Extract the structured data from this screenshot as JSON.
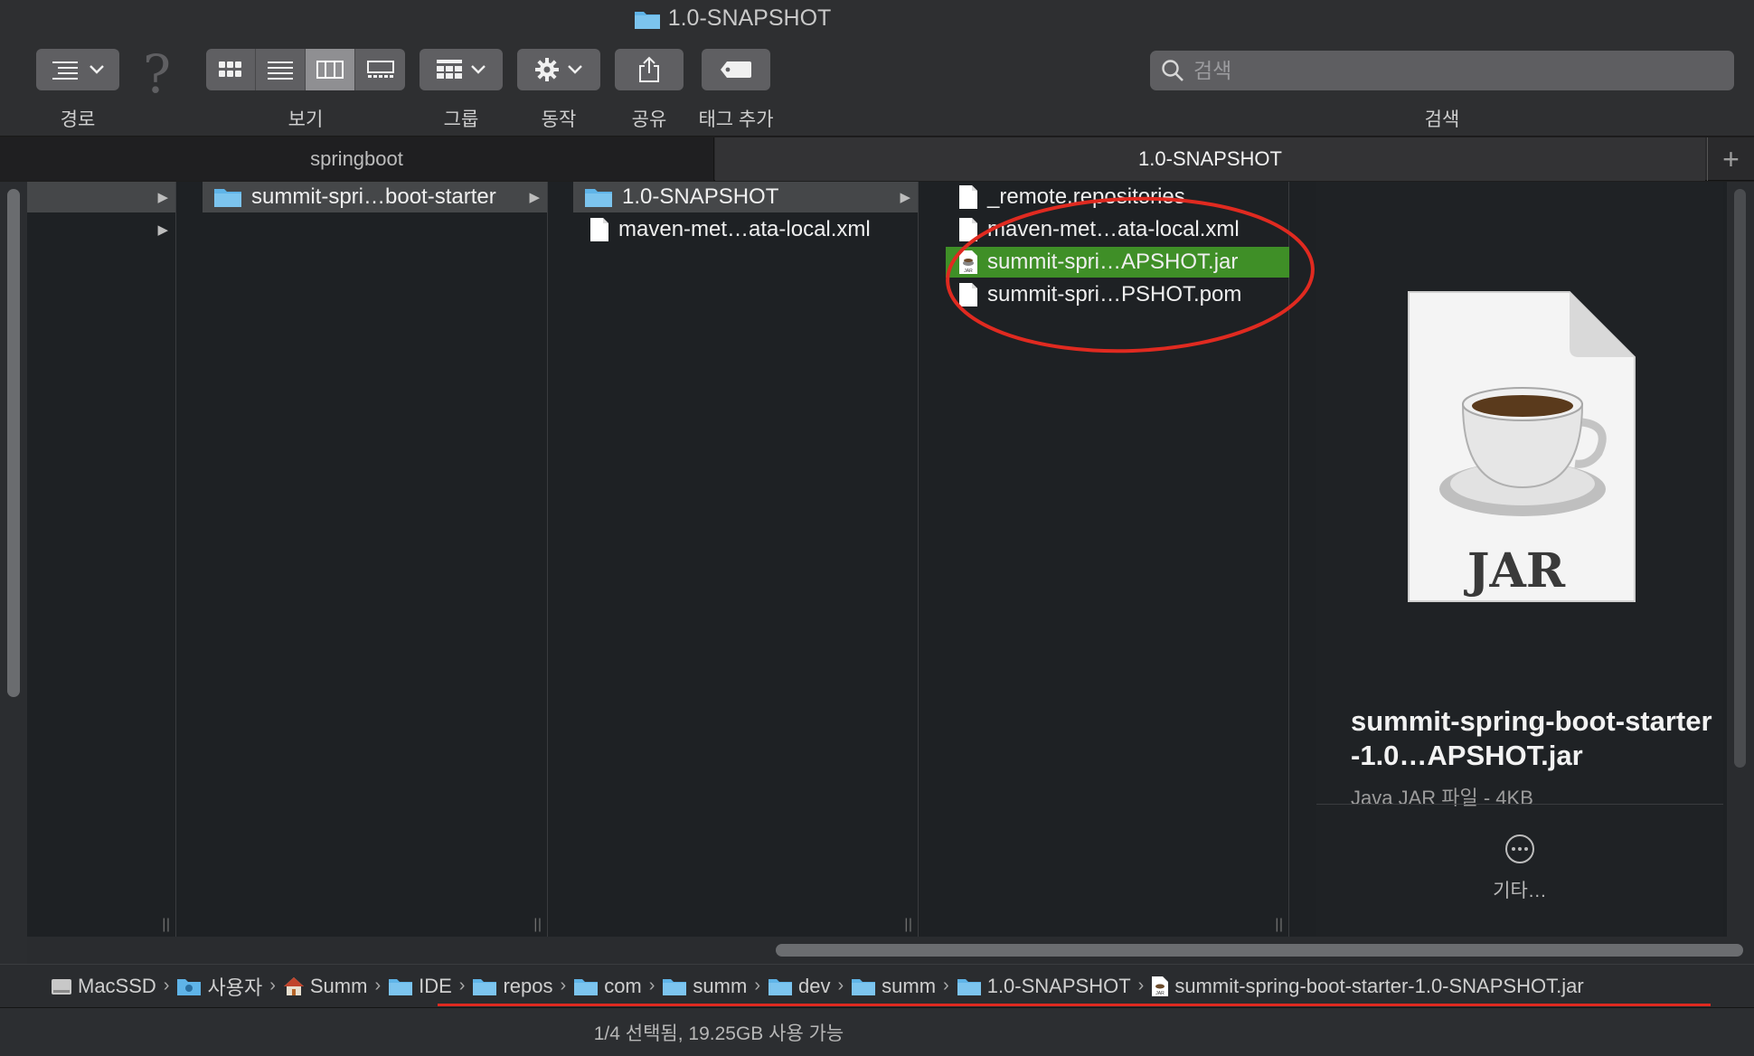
{
  "window": {
    "title": "1.0-SNAPSHOT"
  },
  "toolbar": {
    "path_label": "경로",
    "view_label": "보기",
    "group_label": "그룹",
    "action_label": "동작",
    "share_label": "공유",
    "tag_label": "태그 추가",
    "search_label": "검색",
    "search_placeholder": "검색"
  },
  "tabs": [
    {
      "label": "springboot",
      "active": false
    },
    {
      "label": "1.0-SNAPSHOT",
      "active": true
    }
  ],
  "columns": [
    {
      "items": [
        {
          "name": "",
          "type": "folder"
        },
        {
          "name": "",
          "type": "folder"
        }
      ]
    },
    {
      "items": [
        {
          "name": "summit-spri…boot-starter",
          "type": "folder"
        }
      ]
    },
    {
      "items": [
        {
          "name": "1.0-SNAPSHOT",
          "type": "folder"
        },
        {
          "name": "maven-met…ata-local.xml",
          "type": "file"
        }
      ]
    },
    {
      "items": [
        {
          "name": "_remote.repositories",
          "type": "file"
        },
        {
          "name": "maven-met…ata-local.xml",
          "type": "file"
        },
        {
          "name": "summit-spri…APSHOT.jar",
          "type": "jar",
          "selected": true
        },
        {
          "name": "summit-spri…PSHOT.pom",
          "type": "file"
        }
      ]
    }
  ],
  "preview": {
    "icon_text": "JAR",
    "name": "summit-spring-boot-starter-1.0…APSHOT.jar",
    "kind": "Java JAR 파일 - 4KB",
    "more_label": "기타…"
  },
  "pathbar": {
    "items": [
      {
        "label": "MacSSD",
        "icon": "disk-icon"
      },
      {
        "label": "사용자",
        "icon": "users-folder-icon"
      },
      {
        "label": "Summ",
        "icon": "home-icon"
      },
      {
        "label": "IDE",
        "icon": "folder-icon"
      },
      {
        "label": "repos",
        "icon": "folder-icon"
      },
      {
        "label": "com",
        "icon": "folder-icon"
      },
      {
        "label": "summ",
        "icon": "folder-icon"
      },
      {
        "label": "dev",
        "icon": "folder-icon"
      },
      {
        "label": "summ",
        "icon": "folder-icon"
      },
      {
        "label": "1.0-SNAPSHOT",
        "icon": "folder-icon"
      },
      {
        "label": "summit-spring-boot-starter-1.0-SNAPSHOT.jar",
        "icon": "jar-icon"
      }
    ]
  },
  "status": {
    "text": "1/4 선택됨, 19.25GB 사용 가능"
  },
  "colors": {
    "selection_green": "#3f8f27",
    "annotation_red": "#e02a20",
    "folder_blue": "#5fb4e8"
  }
}
